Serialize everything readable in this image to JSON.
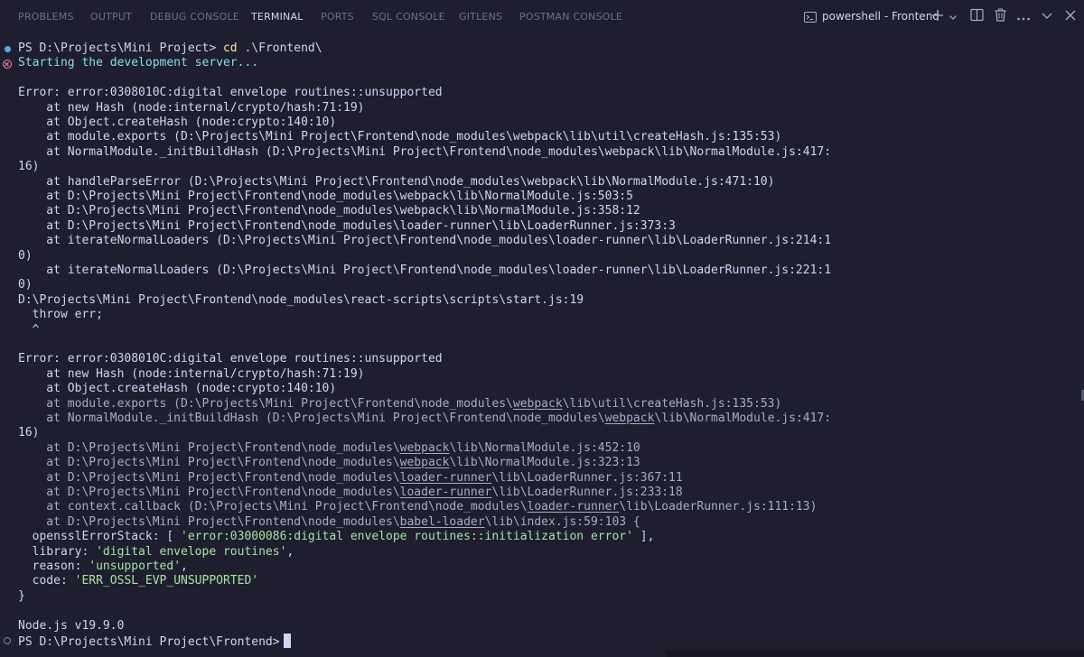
{
  "panel": {
    "tabs": [
      "PROBLEMS",
      "OUTPUT",
      "DEBUG CONSOLE",
      "TERMINAL",
      "PORTS",
      "SQL CONSOLE",
      "GITLENS",
      "POSTMAN CONSOLE"
    ],
    "active_tab": "TERMINAL",
    "terminal_name": "powershell - Frontend",
    "icons": [
      "terminal-icon",
      "plus-icon",
      "chevron-down-icon",
      "split-icon",
      "trash-icon",
      "ellipsis-icon",
      "chevron-down-icon"
    ]
  },
  "terminal": {
    "prompt1": "PS D:\\Projects\\Mini Project>",
    "cmd1": "cd",
    "arg1": ".\\Frontend\\",
    "starting": "Starting the development server...",
    "err1_l1": "Error: error:0308010C:digital envelope routines::unsupported",
    "err1_l2": "    at new Hash (node:internal/crypto/hash:71:19)",
    "err1_l3": "    at Object.createHash (node:crypto:140:10)",
    "err1_l4": "    at module.exports (D:\\Projects\\Mini Project\\Frontend\\node_modules\\webpack\\lib\\util\\createHash.js:135:53)",
    "err1_l5": "    at NormalModule._initBuildHash (D:\\Projects\\Mini Project\\Frontend\\node_modules\\webpack\\lib\\NormalModule.js:417:",
    "err1_l6": "16)",
    "err1_l7": "    at handleParseError (D:\\Projects\\Mini Project\\Frontend\\node_modules\\webpack\\lib\\NormalModule.js:471:10)",
    "err1_l8": "    at D:\\Projects\\Mini Project\\Frontend\\node_modules\\webpack\\lib\\NormalModule.js:503:5",
    "err1_l9": "    at D:\\Projects\\Mini Project\\Frontend\\node_modules\\webpack\\lib\\NormalModule.js:358:12",
    "err1_l10": "    at D:\\Projects\\Mini Project\\Frontend\\node_modules\\loader-runner\\lib\\LoaderRunner.js:373:3",
    "err1_l11": "    at iterateNormalLoaders (D:\\Projects\\Mini Project\\Frontend\\node_modules\\loader-runner\\lib\\LoaderRunner.js:214:1",
    "err1_l12": "0)",
    "err1_l13": "    at iterateNormalLoaders (D:\\Projects\\Mini Project\\Frontend\\node_modules\\loader-runner\\lib\\LoaderRunner.js:221:1",
    "err1_l14": "0)",
    "start_path": "D:\\Projects\\Mini Project\\Frontend\\node_modules\\react-scripts\\scripts\\start.js:19",
    "throw_line": "  throw err;",
    "caret_line": "  ^",
    "err2_l1": "Error: error:0308010C:digital envelope routines::unsupported",
    "err2_l2": "    at new Hash (node:internal/crypto/hash:71:19)",
    "err2_l3": "    at Object.createHash (node:crypto:140:10)",
    "err2_l4_a": "    at module.exports (D:\\Projects\\Mini Project\\Frontend\\node_modules\\",
    "err2_l4_b": "webpack",
    "err2_l4_c": "\\lib\\util\\createHash.js:135:53)",
    "err2_l5_a": "    at NormalModule._initBuildHash (D:\\Projects\\Mini Project\\Frontend\\node_modules\\",
    "err2_l5_b": "webpack",
    "err2_l5_c": "\\lib\\NormalModule.js:417:",
    "err2_l6": "16)",
    "err2_l7_a": "    at D:\\Projects\\Mini Project\\Frontend\\node_modules\\",
    "err2_l7_b": "webpack",
    "err2_l7_c": "\\lib\\NormalModule.js:452:10",
    "err2_l8_a": "    at D:\\Projects\\Mini Project\\Frontend\\node_modules\\",
    "err2_l8_b": "webpack",
    "err2_l8_c": "\\lib\\NormalModule.js:323:13",
    "err2_l9_a": "    at D:\\Projects\\Mini Project\\Frontend\\node_modules\\",
    "err2_l9_b": "loader-runner",
    "err2_l9_c": "\\lib\\LoaderRunner.js:367:11",
    "err2_l10_a": "    at D:\\Projects\\Mini Project\\Frontend\\node_modules\\",
    "err2_l10_b": "loader-runner",
    "err2_l10_c": "\\lib\\LoaderRunner.js:233:18",
    "err2_l11_a": "    at context.callback (D:\\Projects\\Mini Project\\Frontend\\node_modules\\",
    "err2_l11_b": "loader-runner",
    "err2_l11_c": "\\lib\\LoaderRunner.js:111:13)",
    "err2_l12_a": "    at D:\\Projects\\Mini Project\\Frontend\\node_modules\\",
    "err2_l12_b": "babel-loader",
    "err2_l12_c": "\\lib\\index.js:59:103 {",
    "stack_key": "  opensslErrorStack: [ ",
    "stack_val": "'error:03000086:digital envelope routines::initialization error'",
    "stack_end": " ],",
    "library_key": "  library: ",
    "library_val": "'digital envelope routines'",
    "library_end": ",",
    "reason_key": "  reason: ",
    "reason_val": "'unsupported'",
    "reason_end": ",",
    "code_key": "  code: ",
    "code_val": "'ERR_OSSL_EVP_UNSUPPORTED'",
    "close_brace": "}",
    "node_version": "Node.js v19.9.0",
    "prompt2": "PS D:\\Projects\\Mini Project\\Frontend>"
  },
  "colors": {
    "background": "#1e1e2e",
    "foreground": "#cdd6f4",
    "command": "#f9e2af",
    "info": "#89dceb",
    "string": "#a6e3a1",
    "error_decoration": "#f38ba8",
    "success_decoration": "#5aa9e6"
  }
}
